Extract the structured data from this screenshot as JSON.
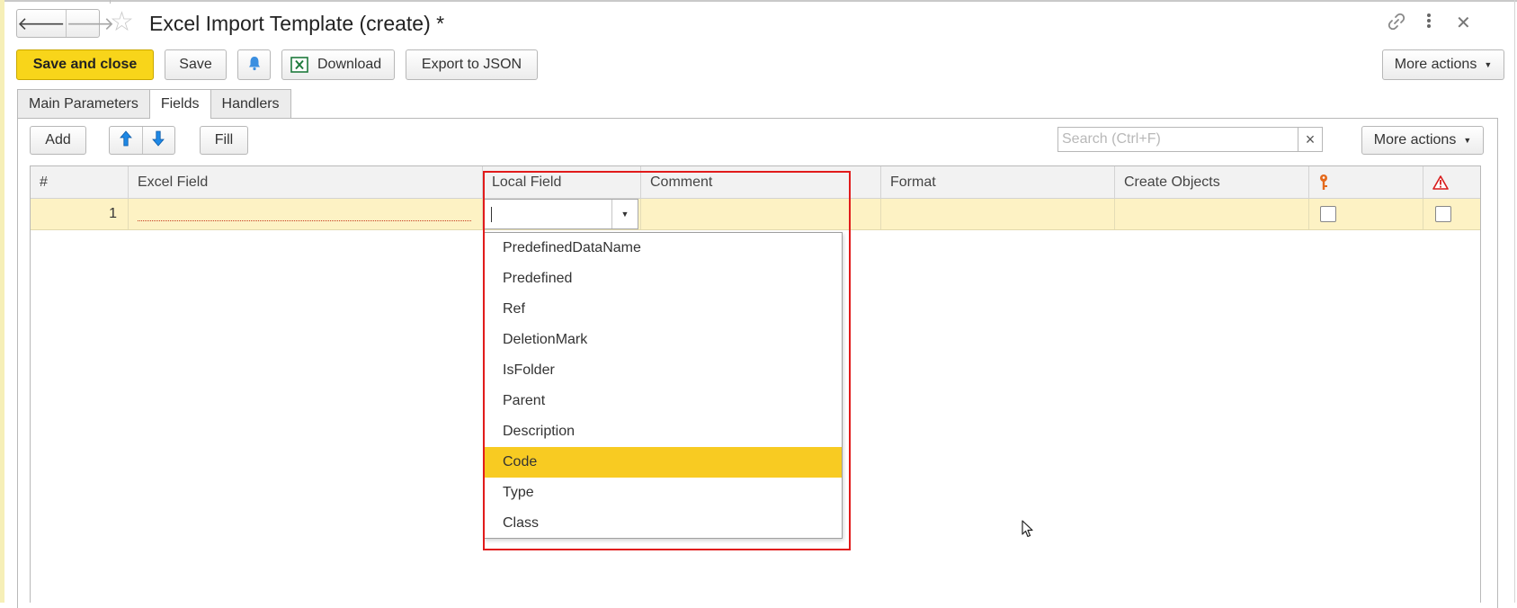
{
  "window": {
    "title": "Excel Import Template (create) *",
    "icons": [
      "arrow-left-icon",
      "arrow-right-icon",
      "star-icon",
      "link-icon",
      "more-vertical-icon",
      "close-icon"
    ]
  },
  "toolbar": {
    "save_and_close": "Save and close",
    "save": "Save",
    "download": "Download",
    "export_json": "Export to JSON",
    "more_actions": "More actions",
    "bell_icon": "bell-icon",
    "excel_icon": "excel-icon"
  },
  "tabs": [
    {
      "label": "Main Parameters",
      "active": false
    },
    {
      "label": "Fields",
      "active": true
    },
    {
      "label": "Handlers",
      "active": false
    }
  ],
  "fields_toolbar": {
    "add": "Add",
    "fill": "Fill",
    "move_up_icon": "arrow-up-icon",
    "move_down_icon": "arrow-down-icon",
    "search_placeholder": "Search (Ctrl+F)",
    "clear": "×",
    "more_actions": "More actions"
  },
  "table": {
    "columns": [
      "#",
      "Excel Field",
      "Local Field",
      "Comment",
      "Format",
      "Create Objects",
      "key-icon",
      "warning-icon"
    ],
    "rows": [
      {
        "number": "1",
        "excel_field": "",
        "local_field": "",
        "comment": "",
        "format": "",
        "create_objects": "",
        "key_checked": false,
        "warning_checked": false
      }
    ]
  },
  "dropdown": {
    "options": [
      "PredefinedDataName",
      "Predefined",
      "Ref",
      "DeletionMark",
      "IsFolder",
      "Parent",
      "Description",
      "Code",
      "Type",
      "Class"
    ],
    "selected": "Code"
  },
  "colors": {
    "primary_button": "#f8d51a",
    "selected_row": "#fdf2c4",
    "selected_option": "#f8cb22",
    "highlight_border": "#e11b1b",
    "accent_blue": "#1e88e5"
  }
}
